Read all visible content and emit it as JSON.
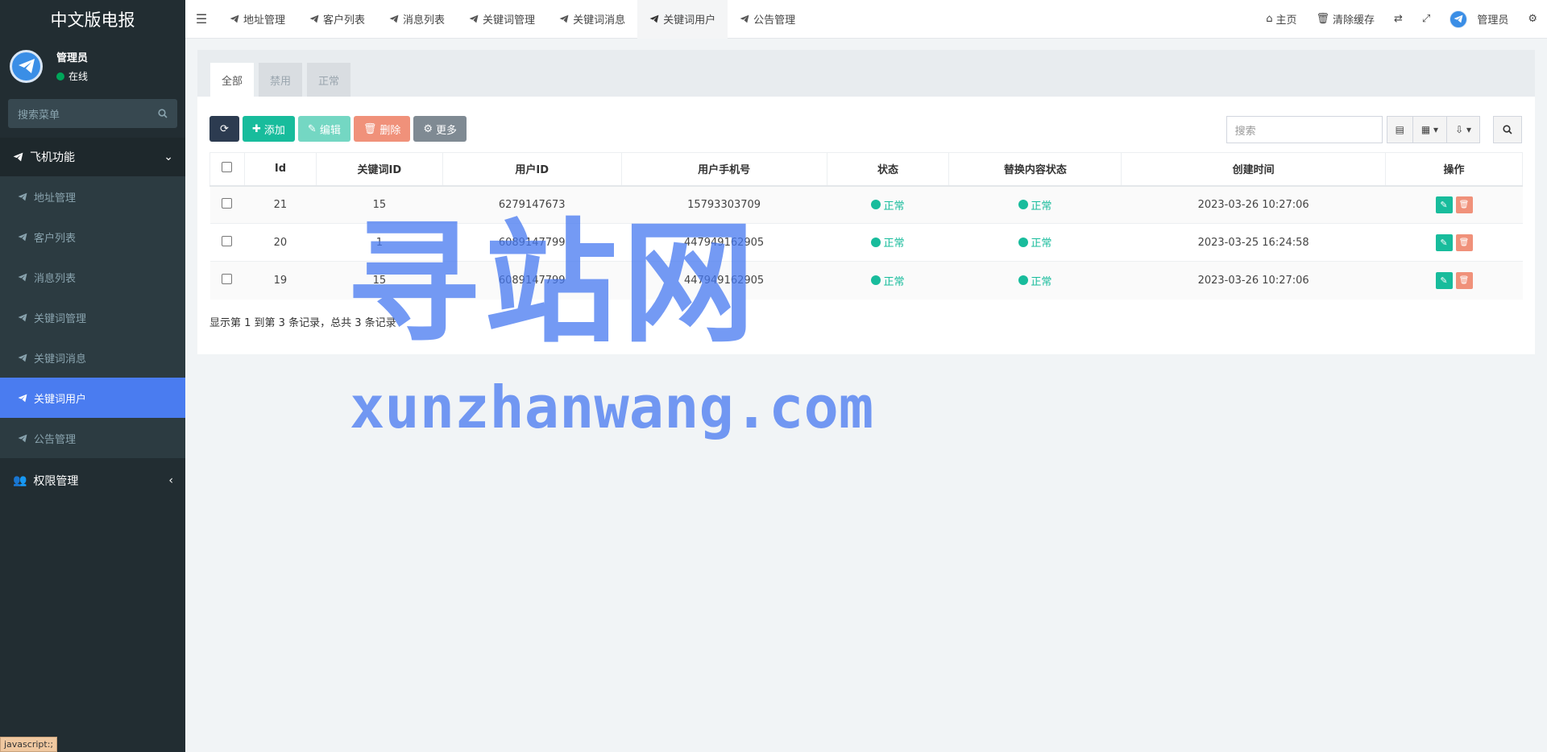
{
  "sidebar": {
    "brand": "中文版电报",
    "user": {
      "name": "管理员",
      "status": "在线"
    },
    "search_placeholder": "搜索菜单",
    "group1": {
      "label": "飞机功能",
      "items": [
        {
          "label": "地址管理"
        },
        {
          "label": "客户列表"
        },
        {
          "label": "消息列表"
        },
        {
          "label": "关键词管理"
        },
        {
          "label": "关键词消息"
        },
        {
          "label": "关键词用户"
        },
        {
          "label": "公告管理"
        }
      ]
    },
    "group2": {
      "label": "权限管理"
    },
    "status_tip": "javascript:;"
  },
  "topnav": {
    "tabs": [
      {
        "label": "地址管理"
      },
      {
        "label": "客户列表"
      },
      {
        "label": "消息列表"
      },
      {
        "label": "关键词管理"
      },
      {
        "label": "关键词消息"
      },
      {
        "label": "关键词用户"
      },
      {
        "label": "公告管理"
      }
    ],
    "home": "主页",
    "clear_cache": "清除缓存",
    "admin": "管理员"
  },
  "panel": {
    "tabs": [
      {
        "label": "全部"
      },
      {
        "label": "禁用"
      },
      {
        "label": "正常"
      }
    ],
    "toolbar": {
      "add": "添加",
      "edit": "编辑",
      "delete": "删除",
      "more": "更多"
    },
    "search_placeholder": "搜索",
    "columns": [
      "Id",
      "关键词ID",
      "用户ID",
      "用户手机号",
      "状态",
      "替换内容状态",
      "创建时间",
      "操作"
    ],
    "rows": [
      {
        "id": "21",
        "keyword_id": "15",
        "user_id": "6279147673",
        "phone": "15793303709",
        "status": "正常",
        "replace_status": "正常",
        "created": "2023-03-26 10:27:06"
      },
      {
        "id": "20",
        "keyword_id": "1",
        "user_id": "6089147799",
        "phone": "447949162905",
        "status": "正常",
        "replace_status": "正常",
        "created": "2023-03-25 16:24:58"
      },
      {
        "id": "19",
        "keyword_id": "15",
        "user_id": "6089147799",
        "phone": "447949162905",
        "status": "正常",
        "replace_status": "正常",
        "created": "2023-03-26 10:27:06"
      }
    ],
    "summary": "显示第 1 到第 3 条记录，总共 3 条记录"
  },
  "watermark": {
    "main": "寻站网",
    "sub": "xunzhanwang.com"
  },
  "colors": {
    "accent": "#4a7cf0",
    "success": "#18bc9c",
    "danger": "#f0917a",
    "sidebar": "#222d32"
  }
}
